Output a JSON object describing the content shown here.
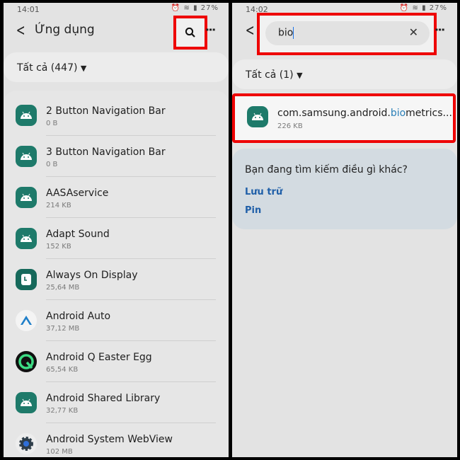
{
  "left": {
    "status": {
      "time": "14:01",
      "battery": "27%"
    },
    "title": "Ứng dụng",
    "filter": "Tất cả (447)",
    "apps": [
      {
        "name": "2 Button Navigation Bar",
        "size": "0 B",
        "icon": "android"
      },
      {
        "name": "3 Button Navigation Bar",
        "size": "0 B",
        "icon": "android"
      },
      {
        "name": "AASAservice",
        "size": "214 KB",
        "icon": "android"
      },
      {
        "name": "Adapt Sound",
        "size": "152 KB",
        "icon": "android"
      },
      {
        "name": "Always On Display",
        "size": "25,64 MB",
        "icon": "clock"
      },
      {
        "name": "Android Auto",
        "size": "37,12 MB",
        "icon": "auto"
      },
      {
        "name": "Android Q Easter Egg",
        "size": "65,54 KB",
        "icon": "q"
      },
      {
        "name": "Android Shared Library",
        "size": "32,77 KB",
        "icon": "android"
      },
      {
        "name": "Android System WebView",
        "size": "102 MB",
        "icon": "gear"
      }
    ]
  },
  "right": {
    "status": {
      "time": "14:02",
      "battery": "27%"
    },
    "search_value": "bio",
    "filter": "Tất cả (1)",
    "result": {
      "name_prefix": "com.samsung.android.",
      "name_highlight": "bio",
      "name_suffix": "metrics...",
      "size": "226 KB",
      "icon": "android"
    },
    "suggest": {
      "heading": "Bạn đang tìm kiếm điều gì khác?",
      "links": [
        "Lưu trữ",
        "Pin"
      ]
    }
  },
  "colors": {
    "highlight_box": "#e00000",
    "match": "#2a7fb8",
    "link": "#1f5fa8",
    "app_icon": "#1e7a6a"
  }
}
